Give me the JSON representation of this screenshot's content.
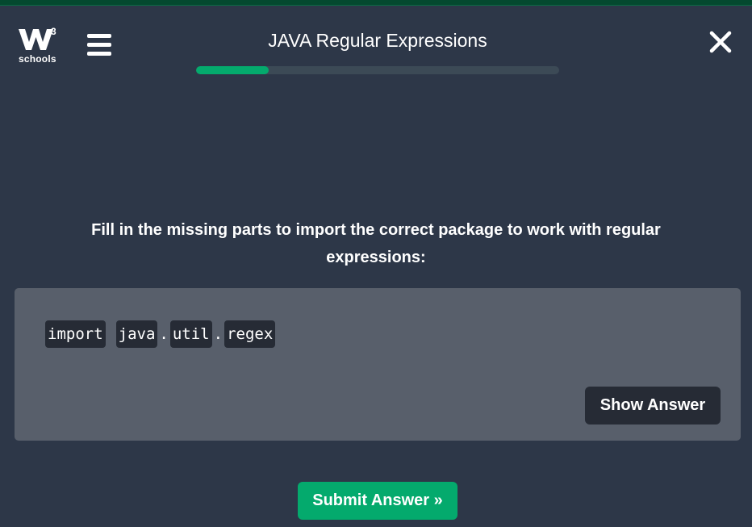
{
  "brand": {
    "logo_text": "schools",
    "superscript": "3",
    "accent": "#04aa6d"
  },
  "header": {
    "title": "JAVA Regular Expressions",
    "progress": 0.2,
    "menu_icon": "hamburger-menu-icon",
    "close_icon": "close-icon"
  },
  "exercise": {
    "instruction": "Fill in the missing parts to import the correct package to work with regular expressions:",
    "code_tokens": {
      "keyword": "import",
      "part1": "java",
      "sep1": ".",
      "part2": "util",
      "sep2": ".",
      "part3": "regex"
    },
    "show_answer_label": "Show Answer",
    "submit_label": "Submit Answer »"
  },
  "colors": {
    "background": "#2d3748",
    "panel": "#585f6b",
    "token_bg": "#262b35",
    "progress_track": "#3c4a56",
    "progress_fill": "#04aa6d"
  }
}
